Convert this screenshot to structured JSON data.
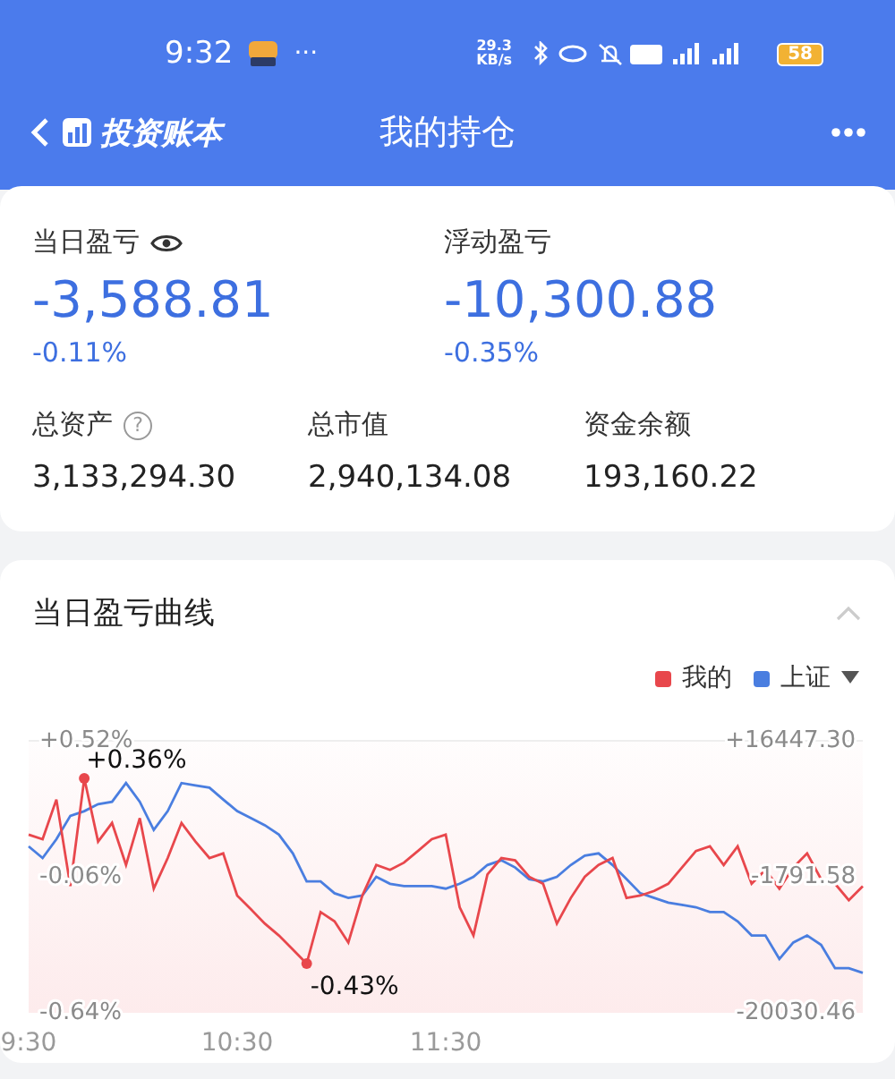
{
  "status_bar": {
    "time": "9:32",
    "more": "···",
    "speed": "29.3 KB/s",
    "battery": "58"
  },
  "nav": {
    "brand": "投资账本",
    "title": "我的持仓"
  },
  "summary": {
    "today": {
      "label": "当日盈亏",
      "value": "-3,588.81",
      "percent": "-0.11%"
    },
    "floating": {
      "label": "浮动盈亏",
      "value": "-10,300.88",
      "percent": "-0.35%"
    },
    "stats": [
      {
        "label": "总资产",
        "help": "?",
        "value": "3,133,294.30"
      },
      {
        "label": "总市值",
        "value": "2,940,134.08"
      },
      {
        "label": "资金余额",
        "value": "193,160.22"
      }
    ]
  },
  "curve": {
    "title": "当日盈亏曲线",
    "expanded": true,
    "right_axis": [
      "+16447.30",
      "-1791.58",
      "-20030.46"
    ],
    "chart_data": {
      "type": "line",
      "ylim": [
        -0.64,
        0.52
      ],
      "categories": [
        "9:30",
        null,
        null,
        null,
        null,
        null,
        null,
        null,
        null,
        null,
        null,
        null,
        null,
        null,
        null,
        "10:30",
        null,
        null,
        null,
        null,
        null,
        null,
        null,
        null,
        null,
        null,
        null,
        null,
        null,
        null,
        "11:30",
        null,
        null,
        null,
        null,
        null,
        null,
        null,
        null,
        null,
        null,
        null,
        null,
        null,
        null,
        null,
        null,
        null,
        null,
        null,
        null,
        null,
        null,
        null,
        null,
        null,
        null,
        null,
        null,
        null,
        null
      ],
      "yticks": [
        {
          "value": 0.52,
          "label": "+0.52%"
        },
        {
          "value": -0.06,
          "label": "-0.06%"
        },
        {
          "value": -0.64,
          "label": "-0.64%"
        }
      ],
      "series": [
        {
          "name": "我的",
          "color": "#e8474c",
          "values": [
            0.12,
            0.1,
            0.27,
            -0.1,
            0.36,
            0.09,
            0.17,
            -0.01,
            0.19,
            -0.11,
            0.02,
            0.17,
            0.09,
            0.02,
            0.04,
            -0.14,
            -0.2,
            -0.26,
            -0.31,
            -0.37,
            -0.43,
            -0.21,
            -0.25,
            -0.34,
            -0.14,
            -0.01,
            -0.03,
            0,
            0.05,
            0.1,
            0.12,
            -0.19,
            -0.31,
            -0.05,
            0.02,
            0.01,
            -0.06,
            -0.09,
            -0.26,
            -0.15,
            -0.06,
            -0.01,
            0.02,
            -0.15,
            -0.14,
            -0.12,
            -0.09,
            -0.02,
            0.05,
            0.07,
            -0.01,
            0.07,
            -0.09,
            -0.03,
            -0.11,
            -0.02,
            0.04,
            -0.07,
            -0.09,
            -0.16,
            -0.1
          ]
        },
        {
          "name": "上证",
          "color": "#4a7ee0",
          "values": [
            0.07,
            0.02,
            0.1,
            0.2,
            0.22,
            0.25,
            0.26,
            0.34,
            0.26,
            0.14,
            0.22,
            0.34,
            0.33,
            0.32,
            0.27,
            0.22,
            0.19,
            0.16,
            0.12,
            0.04,
            -0.08,
            -0.08,
            -0.13,
            -0.15,
            -0.14,
            -0.06,
            -0.09,
            -0.1,
            -0.1,
            -0.1,
            -0.11,
            -0.09,
            -0.06,
            -0.01,
            0.01,
            -0.02,
            -0.07,
            -0.08,
            -0.06,
            -0.01,
            0.03,
            0.04,
            -0.01,
            -0.07,
            -0.13,
            -0.15,
            -0.17,
            -0.18,
            -0.19,
            -0.21,
            -0.21,
            -0.25,
            -0.31,
            -0.31,
            -0.41,
            -0.34,
            -0.31,
            -0.35,
            -0.45,
            -0.45,
            -0.47
          ]
        }
      ],
      "annotations": [
        "+0.36%",
        "-0.43%"
      ]
    }
  }
}
